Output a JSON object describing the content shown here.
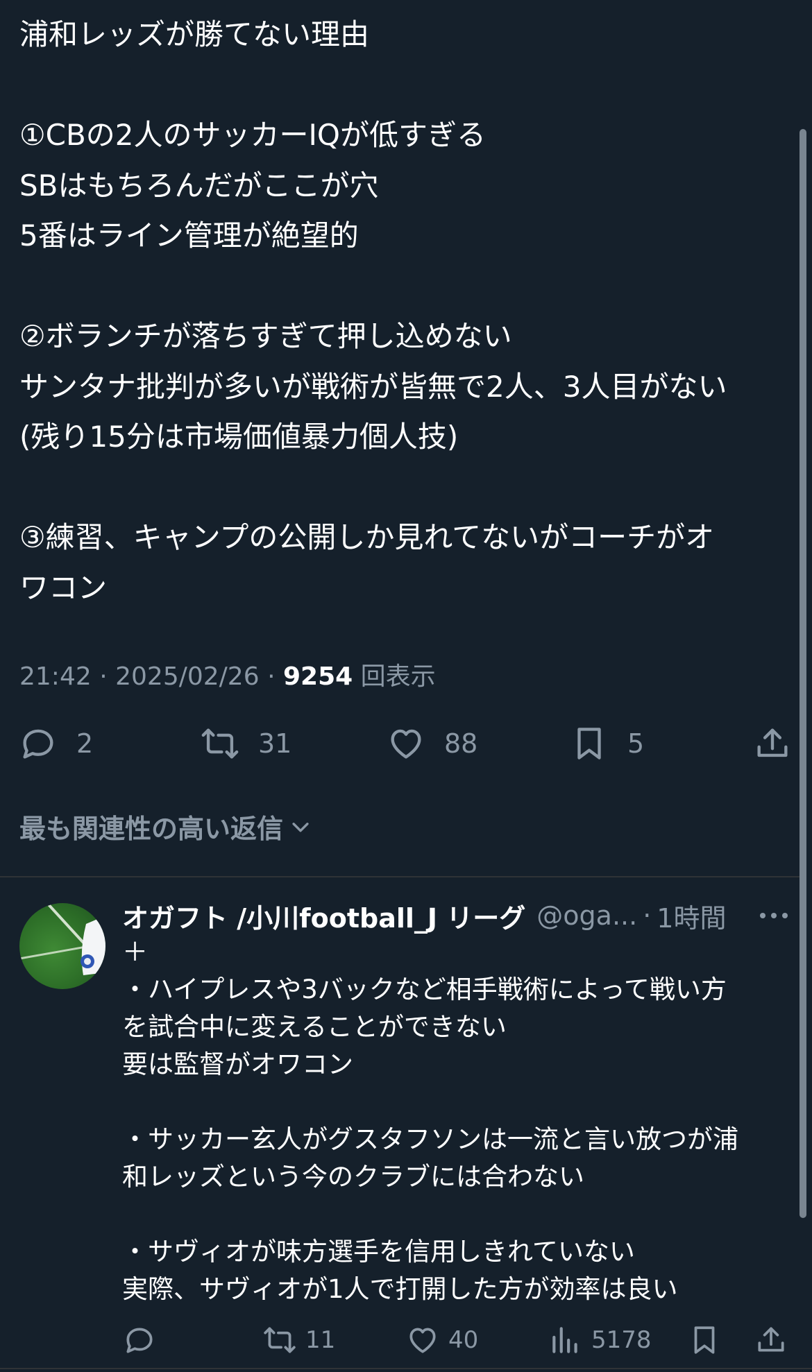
{
  "tweet": {
    "lines": [
      "浦和レッズが勝てない理由",
      "",
      "①CBの2人のサッカーIQが低すぎる",
      "SBはもちろんだがここが穴",
      "5番はライン管理が絶望的",
      "",
      "②ボランチが落ちすぎて押し込めない",
      "サンタナ批判が多いが戦術が皆無で2人、3人目がない",
      "(残り15分は市場価値暴力個人技)",
      "",
      "③練習、キャンプの公開しか見れてないがコーチがオ",
      "ワコン"
    ],
    "time": "21:42",
    "date": "2025/02/26",
    "separator": "·",
    "views_count": "9254",
    "views_label": "回表示",
    "stats": {
      "replies": "2",
      "retweets": "31",
      "likes": "88",
      "bookmarks": "5"
    }
  },
  "relevance_label": "最も関連性の高い返信",
  "reply": {
    "name": "オガフト /小川football_J リーグ",
    "handle": "@oga...",
    "separator": "·",
    "time": "1時間",
    "lines": [
      "＋",
      "・ハイプレスや3バックなど相手戦術によって戦い方",
      "を試合中に変えることができない",
      "要は監督がオワコン",
      "",
      "・サッカー玄人がグスタフソンは一流と言い放つが浦",
      "和レッズという今のクラブには合わない",
      "",
      "・サヴィオが味方選手を信用しきれていない",
      "実際、サヴィオが1人で打開した方が効率は良い"
    ],
    "stats": {
      "retweets": "11",
      "likes": "40",
      "views": "5178"
    }
  },
  "colors": {
    "background": "#15202b",
    "text": "#ffffff",
    "secondary": "#8b98a5",
    "divider": "#2f3336"
  },
  "icons": [
    "reply-icon",
    "retweet-icon",
    "like-icon",
    "bookmark-icon",
    "share-icon",
    "chevron-down-icon",
    "more-icon",
    "analytics-icon"
  ]
}
